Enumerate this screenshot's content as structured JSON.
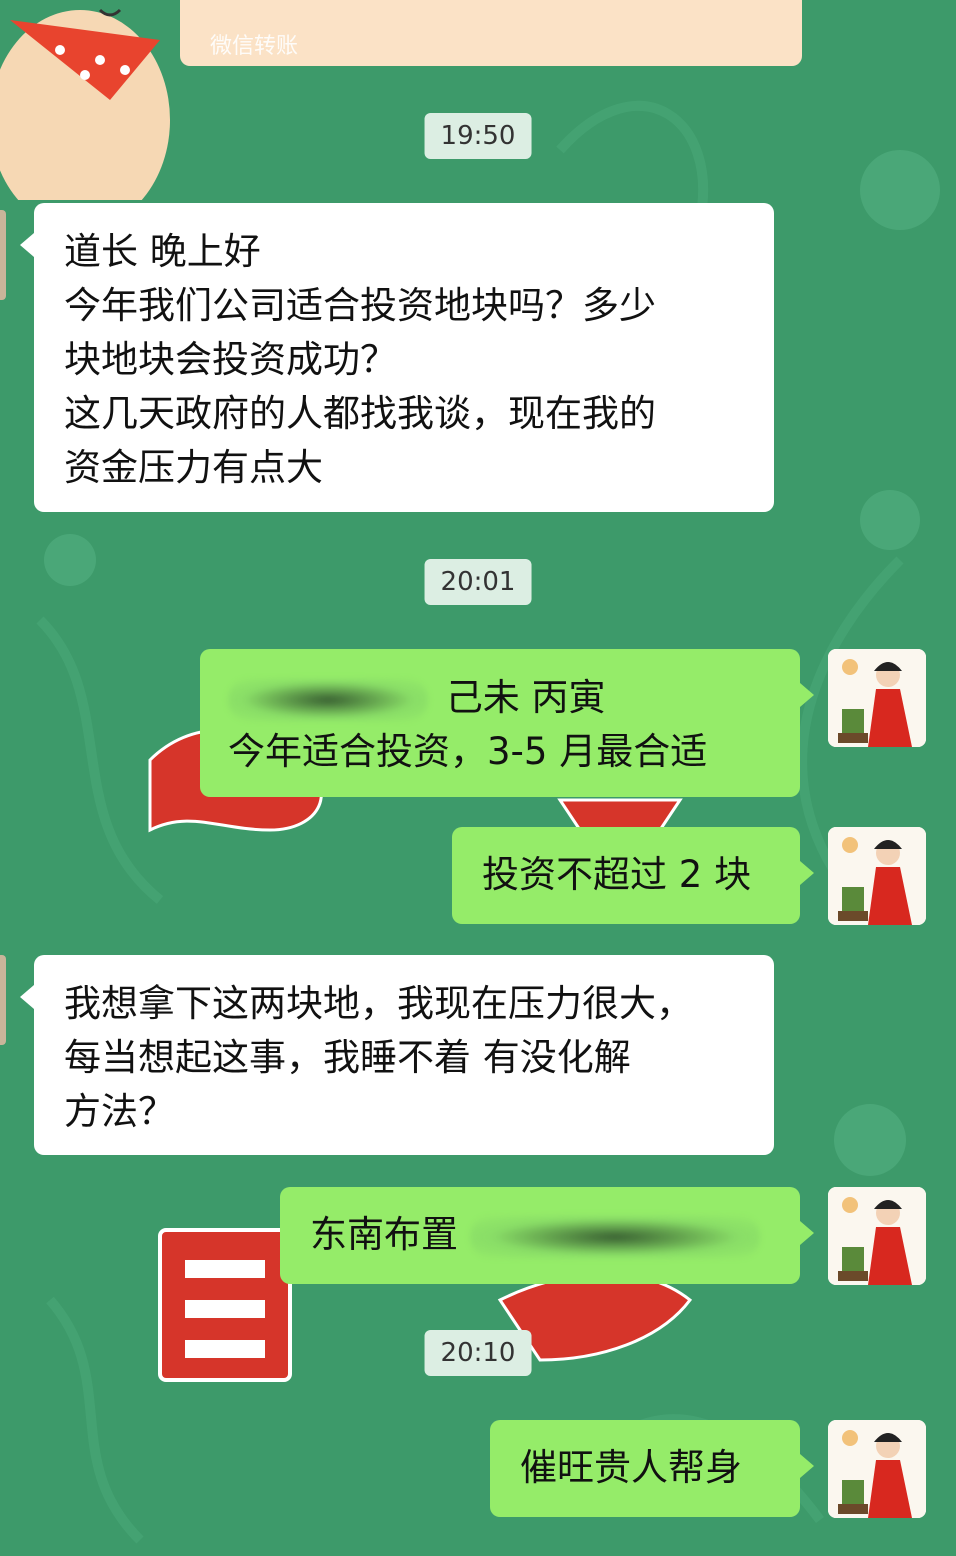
{
  "transfer_card": {
    "label": "微信转账"
  },
  "timestamps": [
    "19:50",
    "20:01",
    "20:10"
  ],
  "messages": {
    "m1": {
      "lines": [
        "道长  晚上好",
        "今年我们公司适合投资地块吗？多少",
        "块地块会投资成功？",
        "这几天政府的人都找我谈，现在我的",
        "资金压力有点大"
      ]
    },
    "m2": {
      "line1_visible": "己未  丙寅",
      "line2": "今年适合投资，3-5 月最合适"
    },
    "m3": {
      "text": "投资不超过 2 块"
    },
    "m4": {
      "lines": [
        "我想拿下这两块地，我现在压力很大，",
        "每当想起这事，我睡不着    有没化解",
        "方法？"
      ]
    },
    "m5": {
      "visible": "东南布置"
    },
    "m6": {
      "text": "催旺贵人帮身"
    }
  },
  "colors": {
    "background": "#3d9a6a",
    "incoming_bubble": "#ffffff",
    "outgoing_bubble": "#95ec69",
    "timestamp_bg": "#dceee3"
  }
}
